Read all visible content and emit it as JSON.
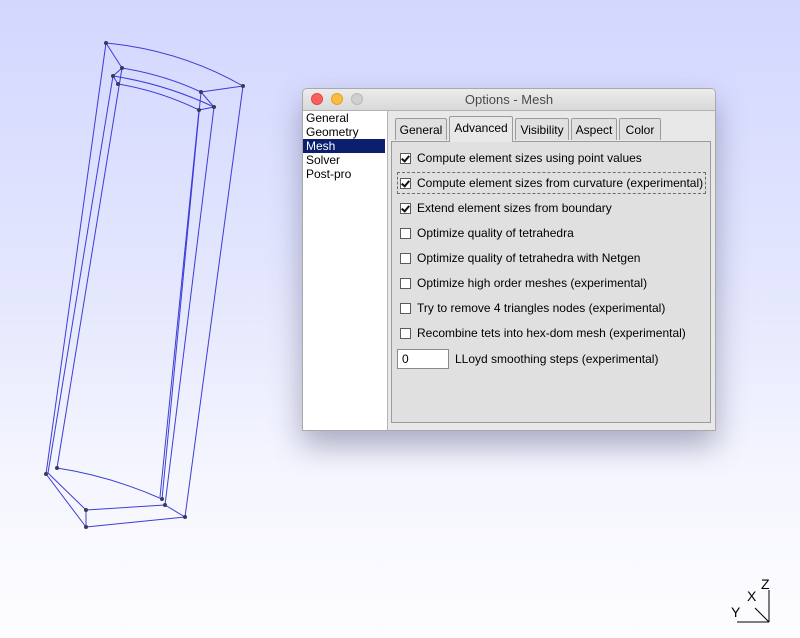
{
  "window": {
    "title": "Options - Mesh"
  },
  "categories": [
    {
      "label": "General",
      "selected": false
    },
    {
      "label": "Geometry",
      "selected": false
    },
    {
      "label": "Mesh",
      "selected": true
    },
    {
      "label": "Solver",
      "selected": false
    },
    {
      "label": "Post-pro",
      "selected": false
    }
  ],
  "tabs": [
    {
      "label": "General",
      "active": false
    },
    {
      "label": "Advanced",
      "active": true
    },
    {
      "label": "Visibility",
      "active": false
    },
    {
      "label": "Aspect",
      "active": false
    },
    {
      "label": "Color",
      "active": false
    }
  ],
  "options": [
    {
      "label": "Compute element sizes using point values",
      "checked": true
    },
    {
      "label": "Compute element sizes from curvature (experimental)",
      "checked": true
    },
    {
      "label": "Extend element sizes from boundary",
      "checked": true
    },
    {
      "label": "Optimize quality of tetrahedra",
      "checked": false
    },
    {
      "label": "Optimize quality of tetrahedra with Netgen",
      "checked": false
    },
    {
      "label": "Optimize high order meshes (experimental)",
      "checked": false
    },
    {
      "label": "Try to remove 4 triangles nodes (experimental)",
      "checked": false
    },
    {
      "label": "Recombine tets into hex-dom mesh (experimental)",
      "checked": false
    }
  ],
  "lloyd": {
    "value": "0",
    "label": "LLoyd smoothing steps (experimental)"
  },
  "axes": {
    "x": "X",
    "y": "Y",
    "z": "Z"
  },
  "colors": {
    "wire": "#3c3cd6",
    "vertex": "#3a3a55",
    "selected_category": "#0c1f6e"
  }
}
